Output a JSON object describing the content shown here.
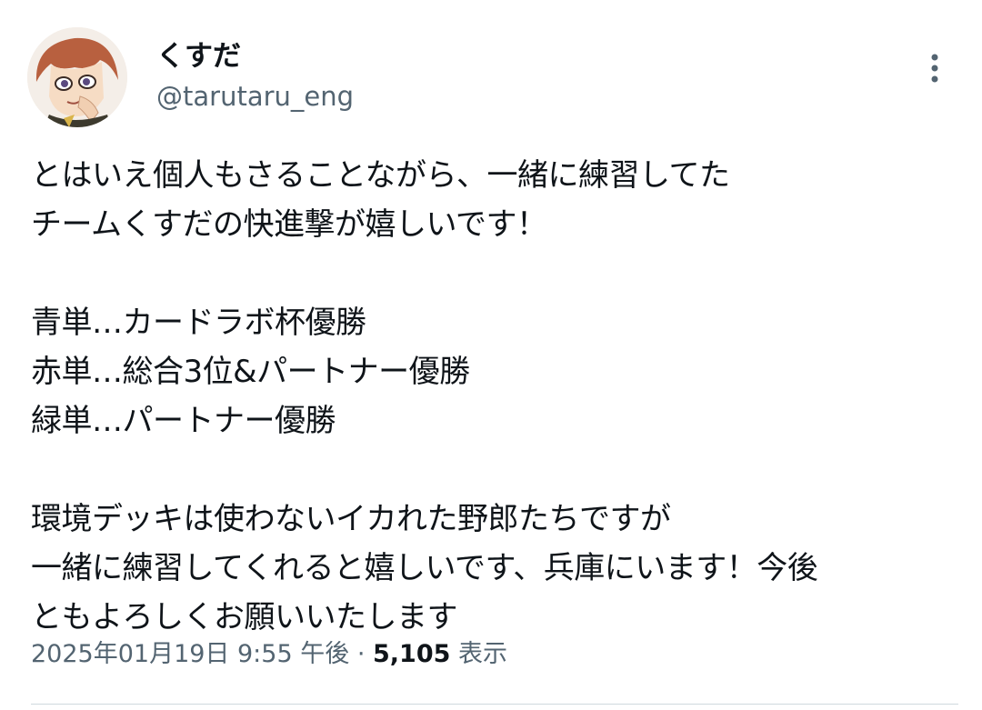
{
  "user": {
    "display_name": "くすだ",
    "handle": "@tarutaru_eng"
  },
  "icons": {
    "avatar": "anime-character-avatar",
    "more": "more-vertical-icon"
  },
  "tweet": {
    "paragraph1": [
      "とはいえ個人もさることながら、一緒に練習してた",
      "チームくすだの快進撃が嬉しいです！"
    ],
    "paragraph2": [
      "青単…カードラボ杯優勝",
      "赤単…総合3位&パートナー優勝",
      "緑単…パートナー優勝"
    ],
    "paragraph3": [
      "環境デッキは使わないイカれた野郎たちですが",
      "一緒に練習してくれると嬉しいです、兵庫にいます！今後",
      "ともよろしくお願いいたします"
    ]
  },
  "meta": {
    "datetime": "2025年01月19日 9:55 午後",
    "separator": " · ",
    "views_count": "5,105",
    "views_label": " 表示"
  },
  "colors": {
    "text": "#0f1419",
    "secondary": "#536471",
    "divider": "#cfd9de"
  }
}
